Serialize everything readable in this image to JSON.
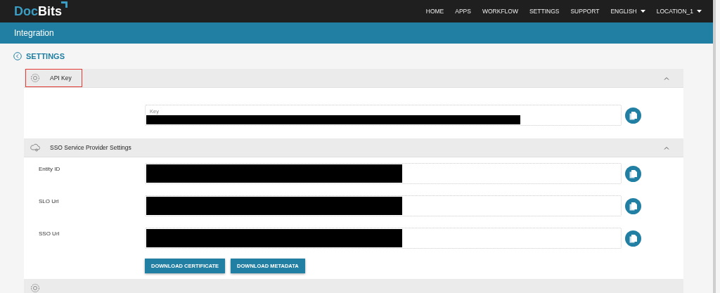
{
  "topbar": {
    "logo": [
      "Doc",
      "Bits"
    ],
    "nav": [
      {
        "label": "HOME",
        "dropdown": false
      },
      {
        "label": "APPS",
        "dropdown": false
      },
      {
        "label": "WORKFLOW",
        "dropdown": false
      },
      {
        "label": "SETTINGS",
        "dropdown": false
      },
      {
        "label": "SUPPORT",
        "dropdown": false
      },
      {
        "label": "ENGLISH",
        "dropdown": true
      },
      {
        "label": "LOCATION_1",
        "dropdown": true
      }
    ]
  },
  "page_bar": {
    "title": "Integration"
  },
  "back_link": {
    "label": "SETTINGS"
  },
  "sections": [
    {
      "kind": "api",
      "title": "API Key",
      "highlighted": true,
      "expanded": true,
      "fields": [
        {
          "floating_label": "Key",
          "redacted": true
        }
      ]
    },
    {
      "kind": "sso",
      "title": "SSO Service Provider Settings",
      "highlighted": false,
      "expanded": true,
      "fields": [
        {
          "label": "Entity ID",
          "redacted": true
        },
        {
          "label": "SLO Url",
          "redacted": true
        },
        {
          "label": "SSO Url",
          "redacted": true
        }
      ],
      "buttons": [
        "DOWNLOAD CERTIFICATE",
        "DOWNLOAD METADATA"
      ]
    },
    {
      "kind": "other",
      "highlighted": false
    }
  ]
}
